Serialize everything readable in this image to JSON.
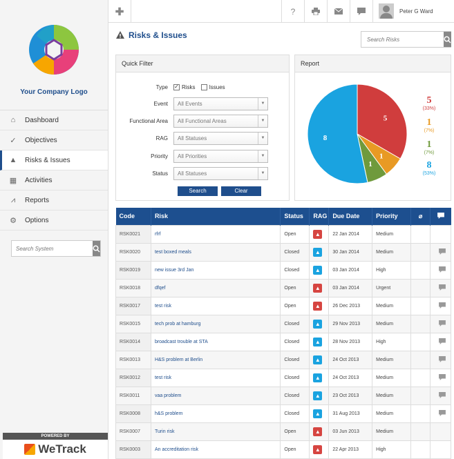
{
  "sidebar": {
    "logo_text": "Your Company Logo",
    "nav": [
      {
        "label": "Dashboard",
        "icon": "home-icon"
      },
      {
        "label": "Objectives",
        "icon": "check-circle-icon"
      },
      {
        "label": "Risks & Issues",
        "icon": "warning-icon"
      },
      {
        "label": "Activities",
        "icon": "calendar-icon"
      },
      {
        "label": "Reports",
        "icon": "chart-icon"
      },
      {
        "label": "Options",
        "icon": "gear-icon"
      }
    ],
    "search_placeholder": "Search System",
    "powered_by": "POWERED BY",
    "brand": "WeTrack"
  },
  "topbar": {
    "user_name": "Peter G Ward",
    "help": "?"
  },
  "page": {
    "title": "Risks & Issues",
    "search_placeholder": "Search Risks"
  },
  "quick_filter": {
    "title": "Quick Filter",
    "type_label": "Type",
    "type_risks": "Risks",
    "type_issues": "Issues",
    "rows": [
      {
        "label": "Event",
        "value": "All Events"
      },
      {
        "label": "Functional Area",
        "value": "All Functional Areas"
      },
      {
        "label": "RAG",
        "value": "All Statuses"
      },
      {
        "label": "Priority",
        "value": "All Priorities"
      },
      {
        "label": "Status",
        "value": "All Statuses"
      }
    ],
    "search_btn": "Search",
    "clear_btn": "Clear"
  },
  "report": {
    "title": "Report",
    "chart_data": {
      "type": "pie",
      "categories": [
        "Red",
        "Amber",
        "Green",
        "Blue"
      ],
      "values": [
        5,
        1,
        1,
        8
      ],
      "percents": [
        "(33%)",
        "(7%)",
        "(7%)",
        "(53%)"
      ],
      "colors": [
        "#d03d3d",
        "#e89a24",
        "#6f9a3c",
        "#1aa3e0"
      ]
    }
  },
  "table": {
    "headers": [
      "Code",
      "Risk",
      "Status",
      "RAG",
      "Due Date",
      "Priority"
    ],
    "rows": [
      {
        "code": "RSK0021",
        "risk": "rfrf",
        "status": "Open",
        "rag": "red",
        "due": "22 Jan 2014",
        "priority": "Medium",
        "chat": false
      },
      {
        "code": "RSK0020",
        "risk": "test boxed meals",
        "status": "Closed",
        "rag": "blue",
        "due": "30 Jan 2014",
        "priority": "Medium",
        "chat": true
      },
      {
        "code": "RSK0019",
        "risk": "new issue 3rd Jan",
        "status": "Closed",
        "rag": "blue",
        "due": "03 Jan 2014",
        "priority": "High",
        "chat": true
      },
      {
        "code": "RSK0018",
        "risk": "dfqef",
        "status": "Open",
        "rag": "red",
        "due": "03 Jan 2014",
        "priority": "Urgent",
        "chat": true
      },
      {
        "code": "RSK0017",
        "risk": "test risk",
        "status": "Open",
        "rag": "red",
        "due": "26 Dec 2013",
        "priority": "Medium",
        "chat": true
      },
      {
        "code": "RSK0015",
        "risk": "tech prob at hamburg",
        "status": "Closed",
        "rag": "blue",
        "due": "29 Nov 2013",
        "priority": "Medium",
        "chat": true
      },
      {
        "code": "RSK0014",
        "risk": "broadcast trouble at STA",
        "status": "Closed",
        "rag": "blue",
        "due": "28 Nov 2013",
        "priority": "High",
        "chat": true
      },
      {
        "code": "RSK0013",
        "risk": "H&S problem at Berlin",
        "status": "Closed",
        "rag": "blue",
        "due": "24 Oct 2013",
        "priority": "Medium",
        "chat": true
      },
      {
        "code": "RSK0012",
        "risk": "test risk",
        "status": "Closed",
        "rag": "blue",
        "due": "24 Oct 2013",
        "priority": "Medium",
        "chat": true
      },
      {
        "code": "RSK0011",
        "risk": "vaa problem",
        "status": "Closed",
        "rag": "blue",
        "due": "23 Oct 2013",
        "priority": "Medium",
        "chat": true
      },
      {
        "code": "RSK0008",
        "risk": "h&S problem",
        "status": "Closed",
        "rag": "blue",
        "due": "31 Aug 2013",
        "priority": "Medium",
        "chat": true
      },
      {
        "code": "RSK0007",
        "risk": "Turin risk",
        "status": "Open",
        "rag": "red",
        "due": "03 Jun 2013",
        "priority": "Medium",
        "chat": false
      },
      {
        "code": "RSK0003",
        "risk": "An accreditation risk",
        "status": "Open",
        "rag": "red",
        "due": "22 Apr 2013",
        "priority": "High",
        "chat": false
      }
    ]
  }
}
